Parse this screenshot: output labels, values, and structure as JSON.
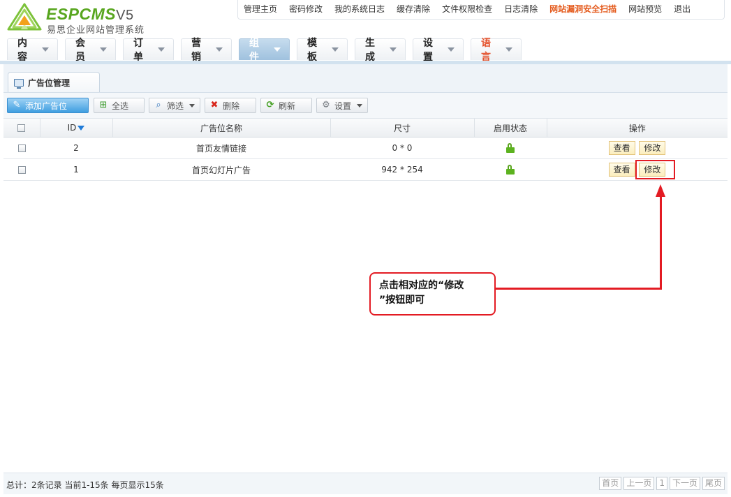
{
  "logo": {
    "brand": "ESPCMS",
    "version": "V5",
    "subtitle": "易思企业网站管理系统"
  },
  "top_links": [
    "管理主页",
    "密码修改",
    "我的系统日志",
    "缓存清除",
    "文件权限检查",
    "日志清除",
    "网站漏洞安全扫描",
    "网站预览",
    "退出"
  ],
  "main_nav": [
    "内容",
    "会员",
    "订单",
    "营销",
    "组件",
    "模板",
    "生成",
    "设置",
    "语言"
  ],
  "panel": {
    "tab_title": "广告位管理"
  },
  "toolbar": {
    "add": "添加广告位",
    "select_all": "全选",
    "filter": "筛选",
    "delete": "删除",
    "refresh": "刷新",
    "settings": "设置"
  },
  "table": {
    "headers": {
      "id": "ID",
      "name": "广告位名称",
      "size": "尺寸",
      "status": "启用状态",
      "ops": "操作"
    },
    "rows": [
      {
        "id": "2",
        "name": "首页友情链接",
        "size": "0 * 0",
        "view": "查看",
        "edit": "修改"
      },
      {
        "id": "1",
        "name": "首页幻灯片广告",
        "size": "942 * 254",
        "view": "查看",
        "edit": "修改"
      }
    ]
  },
  "annotation": {
    "line1": "点击相对应的“修改",
    "line2": "”按钮即可"
  },
  "footer": {
    "summary": "总计：2条记录 当前1-15条 每页显示15条",
    "pager": {
      "first": "首页",
      "prev": "上一页",
      "current": "1",
      "next": "下一页",
      "last": "尾页"
    }
  },
  "colors": {
    "brand_green": "#58a61f",
    "nav_active": "#9fc1de",
    "highlight_orange": "#e45a1c",
    "annotation_red": "#e31b23"
  }
}
